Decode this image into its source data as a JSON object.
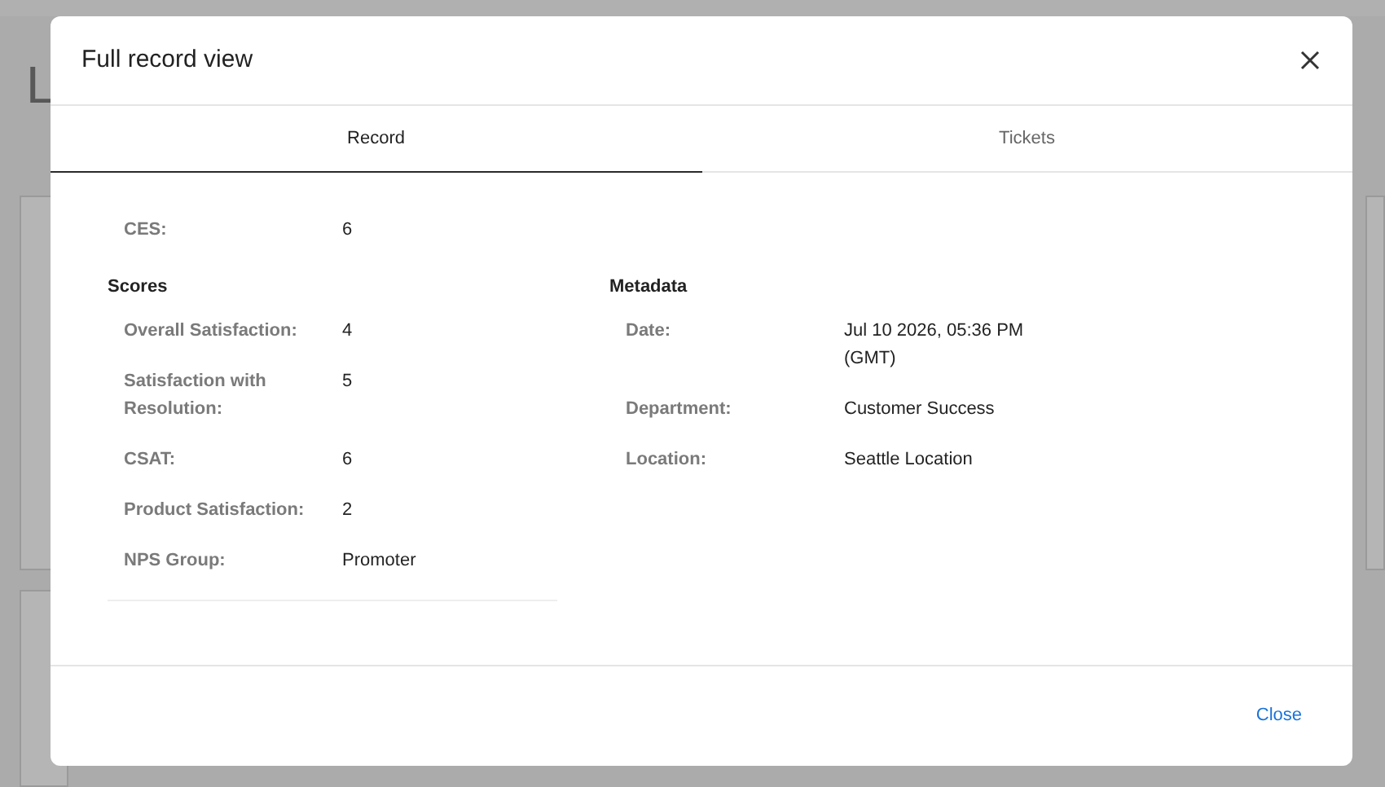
{
  "background": {
    "page_title": "L"
  },
  "dialog": {
    "title": "Full record view",
    "tabs": [
      {
        "label": "Record",
        "selected": true
      },
      {
        "label": "Tickets",
        "selected": false
      }
    ],
    "top_fields": [
      {
        "label": "CES:",
        "value": "6"
      }
    ],
    "sections": [
      {
        "heading": "Scores",
        "fields": [
          {
            "label": "Overall Satisfaction:",
            "value": "4"
          },
          {
            "label": "Satisfaction with Resolution:",
            "value": "5"
          },
          {
            "label": "CSAT:",
            "value": "6"
          },
          {
            "label": "Product Satisfaction:",
            "value": "2"
          },
          {
            "label": "NPS Group:",
            "value": "Promoter"
          }
        ]
      },
      {
        "heading": "Metadata",
        "fields": [
          {
            "label": "Date:",
            "value": "Jul 10 2026, 05:36 PM (GMT)"
          },
          {
            "label": "Department:",
            "value": "Customer Success"
          },
          {
            "label": "Location:",
            "value": "Seattle Location"
          }
        ]
      }
    ],
    "close_button": "Close"
  }
}
